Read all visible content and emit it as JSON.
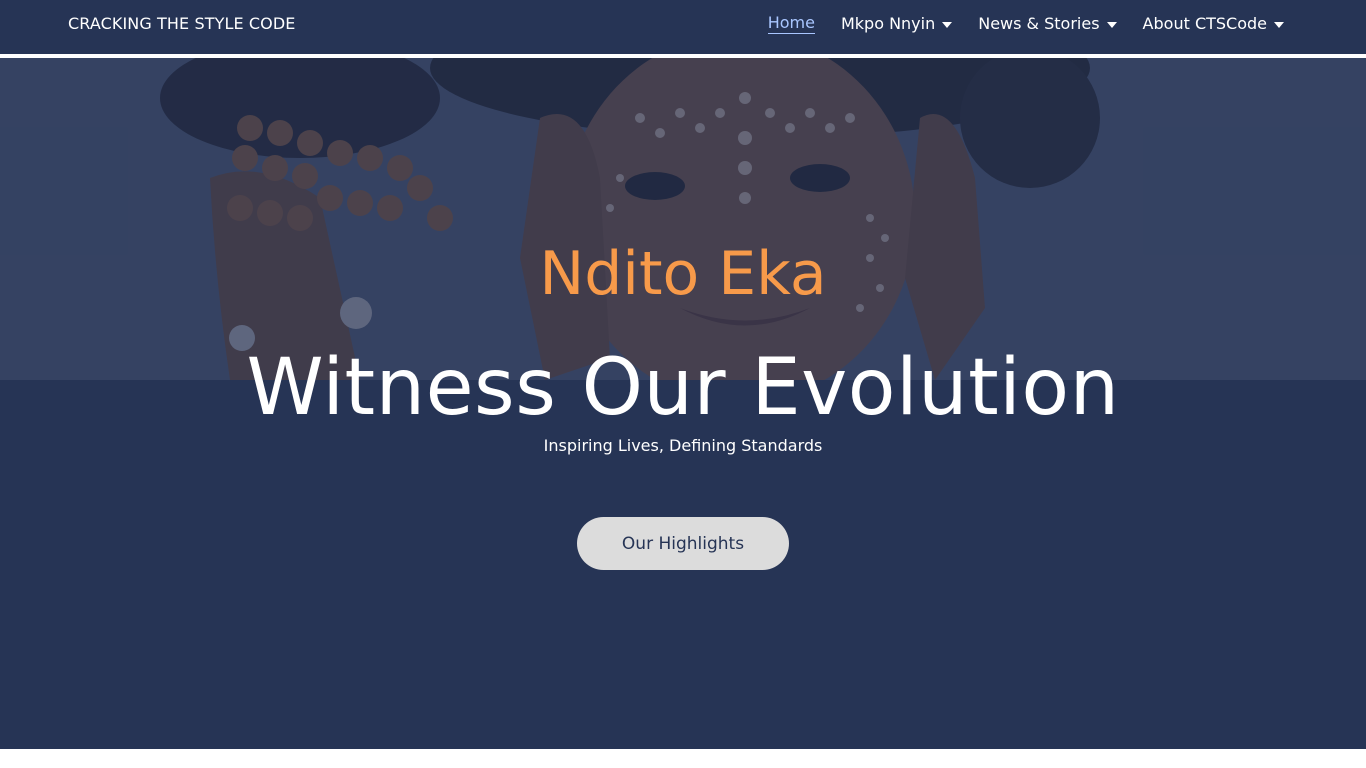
{
  "header": {
    "brand": "CRACKING THE STYLE CODE",
    "nav": [
      {
        "label": "Home",
        "active": true,
        "dropdown": false
      },
      {
        "label": "Mkpo Nnyin",
        "active": false,
        "dropdown": true
      },
      {
        "label": "News & Stories",
        "active": false,
        "dropdown": true
      },
      {
        "label": "About CTSCode",
        "active": false,
        "dropdown": true
      }
    ]
  },
  "hero": {
    "eyebrow": "Ndito Eka",
    "headline": "Witness Our Evolution",
    "tagline": "Inspiring Lives, Defining Standards",
    "cta_label": "Our Highlights"
  },
  "colors": {
    "navy": "#263455",
    "accent_orange": "#f79a4a",
    "active_link": "#a9c6ff",
    "button_bg": "#dcdcdc"
  }
}
